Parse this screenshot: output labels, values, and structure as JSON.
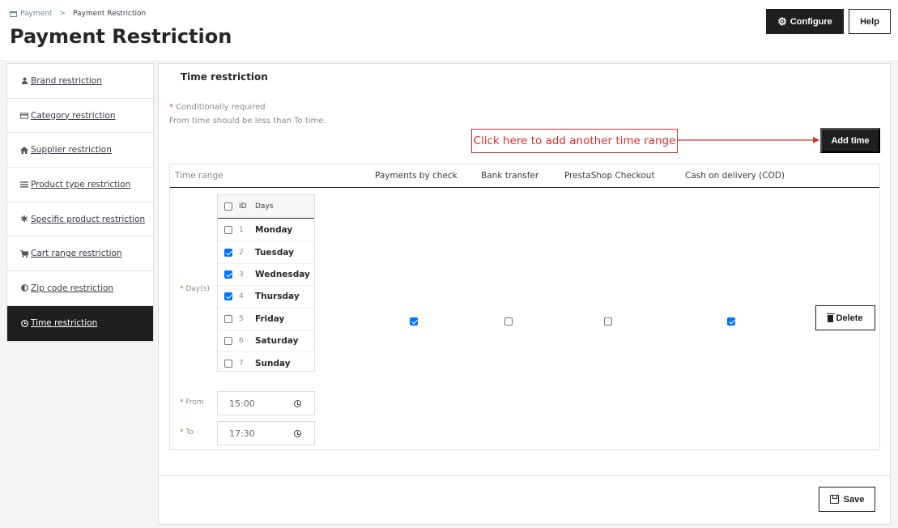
{
  "breadcrumb": {
    "parent": "Payment",
    "separator": ">",
    "current": "Payment Restriction"
  },
  "page_title": "Payment Restriction",
  "toolbar": {
    "configure_label": "Configure",
    "help_label": "Help"
  },
  "sidebar": {
    "items": [
      {
        "label": "Brand restriction",
        "icon": "user-icon",
        "active": false
      },
      {
        "label": "Category restriction",
        "icon": "credit-card-icon",
        "active": false
      },
      {
        "label": "Supplier restriction",
        "icon": "home-icon",
        "active": false
      },
      {
        "label": "Product type restriction",
        "icon": "list-icon",
        "active": false
      },
      {
        "label": "Specific product restriction",
        "icon": "asterisk-icon",
        "active": false
      },
      {
        "label": "Cart range restriction",
        "icon": "cart-icon",
        "active": false
      },
      {
        "label": "Zip code restriction",
        "icon": "adjust-icon",
        "active": false
      },
      {
        "label": "Time restriction",
        "icon": "clock-icon",
        "active": true
      }
    ]
  },
  "main": {
    "title": "Time restriction",
    "required_note": "Conditionally required",
    "required_mark": "*",
    "time_note": "From time should be less than To time.",
    "add_time_label": "Add time",
    "annotation": "Click here to add another time range",
    "table": {
      "columns": [
        "Time range",
        "Payments by check",
        "Bank transfer",
        "PrestaShop Checkout",
        "Cash on delivery (COD)"
      ],
      "days_label": "Day(s)",
      "days_header": {
        "id": "ID",
        "days": "Days"
      },
      "days": [
        {
          "id": "1",
          "name": "Monday",
          "checked": false
        },
        {
          "id": "2",
          "name": "Tuesday",
          "checked": true
        },
        {
          "id": "3",
          "name": "Wednesday",
          "checked": true
        },
        {
          "id": "4",
          "name": "Thursday",
          "checked": true
        },
        {
          "id": "5",
          "name": "Friday",
          "checked": false
        },
        {
          "id": "6",
          "name": "Saturday",
          "checked": false
        },
        {
          "id": "7",
          "name": "Sunday",
          "checked": false
        }
      ],
      "from_label": "From",
      "from_value": "15:00",
      "to_label": "To",
      "to_value": "17:30",
      "payments": [
        true,
        false,
        false,
        true
      ],
      "delete_label": "Delete"
    },
    "save_label": "Save"
  },
  "colors": {
    "dark": "#1f1f1f",
    "accent_red": "#d9302b",
    "checkbox_blue": "#0075ff"
  }
}
